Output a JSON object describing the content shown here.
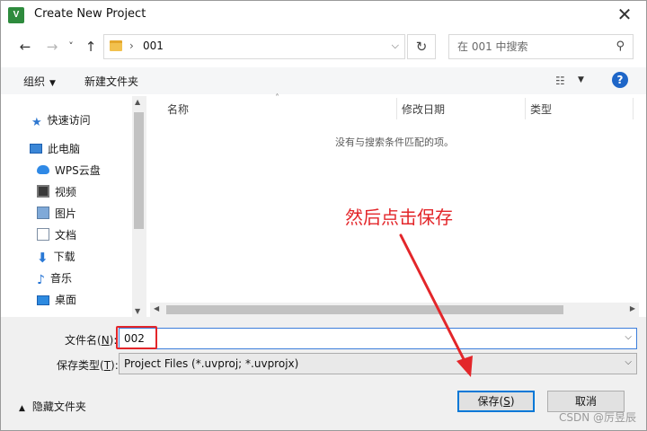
{
  "window": {
    "title": "Create New Project",
    "app_icon_text": "V",
    "close_glyph": "✕"
  },
  "nav": {
    "back_glyph": "←",
    "forward_glyph": "→",
    "recent_glyph": "˅",
    "up_glyph": "↑",
    "crumb_sep": "›",
    "current_folder": "001",
    "address_dropdown_glyph": "⌵",
    "refresh_glyph": "↻",
    "search_placeholder": "在 001 中搜索",
    "search_icon_glyph": "⚲"
  },
  "toolbar": {
    "organize_label": "组织",
    "organize_dd": "▼",
    "new_folder_label": "新建文件夹",
    "view_glyph": "☷",
    "view_dd": "▼",
    "help_label": "?"
  },
  "sidebar": {
    "items": [
      {
        "label": "快速访问",
        "icon": "star-icon"
      },
      {
        "label": "此电脑",
        "icon": "computer-icon"
      },
      {
        "label": "WPS云盘",
        "icon": "cloud-icon"
      },
      {
        "label": "视频",
        "icon": "video-icon"
      },
      {
        "label": "图片",
        "icon": "pictures-icon"
      },
      {
        "label": "文档",
        "icon": "documents-icon"
      },
      {
        "label": "下载",
        "icon": "download-icon"
      },
      {
        "label": "音乐",
        "icon": "music-icon"
      },
      {
        "label": "桌面",
        "icon": "desktop-icon"
      }
    ],
    "star_glyph": "★",
    "down_glyph": "⬇",
    "music_glyph": "♪",
    "scroll_up": "▲",
    "scroll_down": "▼"
  },
  "filelist": {
    "columns": [
      "名称",
      "修改日期",
      "类型"
    ],
    "sort_caret": "˄",
    "empty_message": "没有与搜索条件匹配的项。",
    "scroll_left": "◀",
    "scroll_right": "▶"
  },
  "form": {
    "filename_label_prefix": "文件名(",
    "filename_label_key": "N",
    "filename_label_suffix": "):",
    "filename_value": "002",
    "filetype_label_prefix": "保存类型(",
    "filetype_label_key": "T",
    "filetype_label_suffix": "):",
    "filetype_value": "Project Files (*.uvproj; *.uvprojx)",
    "dropdown_glyph": "⌵"
  },
  "footer": {
    "hide_folders_chevron": "▲",
    "hide_folders_label": "隐藏文件夹",
    "save_label_prefix": "保存(",
    "save_label_key": "S",
    "save_label_suffix": ")",
    "cancel_label": "取消"
  },
  "annotation": {
    "text": "然后点击保存",
    "color": "#e3262a"
  },
  "watermark": "CSDN @厉昱辰"
}
